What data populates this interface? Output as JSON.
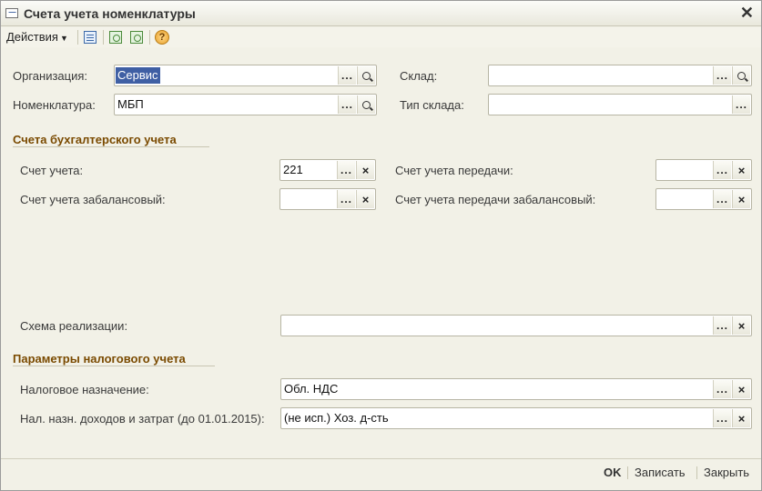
{
  "window": {
    "title": "Счета учета номенклатуры"
  },
  "toolbar": {
    "actions_label": "Действия",
    "help_symbol": "?"
  },
  "organization": {
    "label": "Организация:",
    "value": "Сервис"
  },
  "nomenclature": {
    "label": "Номенклатура:",
    "value": "МБП"
  },
  "warehouse": {
    "label": "Склад:",
    "value": ""
  },
  "warehouse_type": {
    "label": "Тип склада:",
    "value": ""
  },
  "accounting_section": {
    "title": "Счета бухгалтерского учета",
    "account": {
      "label": "Счет учета:",
      "value": "221"
    },
    "offbalance_account": {
      "label": "Счет учета забалансовый:",
      "value": ""
    },
    "transfer_account": {
      "label": "Счет учета передачи:",
      "value": ""
    },
    "transfer_offbalance_account": {
      "label": "Счет учета передачи забалансовый:",
      "value": ""
    },
    "sale_scheme": {
      "label": "Схема реализации:",
      "value": ""
    }
  },
  "tax_section": {
    "title": "Параметры налогового учета",
    "tax_purpose": {
      "label": "Налоговое назначение:",
      "value": "Обл. НДС"
    },
    "income_expense_purpose": {
      "label": "Нал. назн. доходов и затрат (до 01.01.2015):",
      "value": "(не исп.) Хоз. д-сть"
    }
  },
  "buttons": {
    "dots": "...",
    "clear": "×",
    "ok": "OK",
    "save": "Записать",
    "close": "Закрыть"
  }
}
